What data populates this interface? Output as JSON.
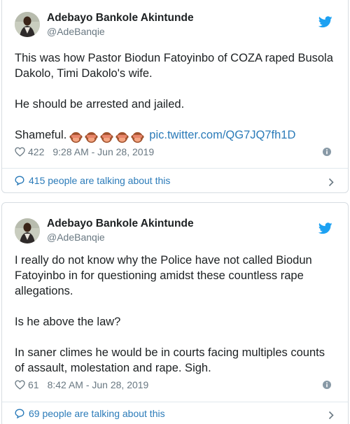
{
  "tweets": [
    {
      "author_name": "Adebayo Bankole Akintunde",
      "author_handle": "@AdeBanqie",
      "paragraphs": [
        "This was how Pastor Biodun Fatoyinbo of COZA raped Busola Dakolo, Timi Dakolo's wife.",
        "He should be arrested and jailed."
      ],
      "closing_text": "Shameful.",
      "emoji_icons": [
        "see-no-evil-monkey",
        "see-no-evil-monkey",
        "see-no-evil-monkey",
        "see-no-evil-monkey",
        "see-no-evil-monkey"
      ],
      "link_text": "pic.twitter.com/QG7JQ7fh1D",
      "likes": "422",
      "timestamp": "9:28 AM - Jun 28, 2019",
      "talking_text": "415 people are talking about this"
    },
    {
      "author_name": "Adebayo Bankole Akintunde",
      "author_handle": "@AdeBanqie",
      "paragraphs": [
        "I really do not know why the Police have not called Biodun Fatoyinbo in for questioning amidst these countless rape allegations.",
        "Is he above the law?",
        "In saner climes he would be in courts facing multiples counts of assault, molestation and rape. Sigh."
      ],
      "likes": "61",
      "timestamp": "8:42 AM - Jun 28, 2019",
      "talking_text": "69 people are talking about this"
    }
  ],
  "colors": {
    "link": "#2b7bb9",
    "twitter_bird": "#1da1f2",
    "meta_gray": "#697882",
    "border": "#d7dde2"
  },
  "icons": {
    "bird": "twitter-bird-icon",
    "heart": "heart-outline-icon",
    "info": "info-icon",
    "bubble": "speech-bubble-icon",
    "chevron": "chevron-right-icon"
  }
}
